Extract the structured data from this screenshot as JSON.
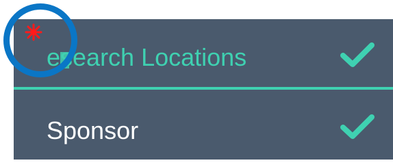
{
  "list": {
    "items": [
      {
        "label": "Research Locations",
        "display_label": "esearch Locations",
        "state": "selected",
        "icon": "check-icon"
      },
      {
        "label": "Sponsor",
        "display_label": "Sponsor",
        "state": "default",
        "icon": "check-icon"
      }
    ]
  },
  "colors": {
    "panel_bg": "#4a5a6d",
    "accent": "#3fd1b1",
    "text_default": "#ffffff",
    "highlight_ring": "#0a76c6",
    "marker": "#ff1a1a"
  },
  "overlay": {
    "icon": "asterisk-icon"
  }
}
